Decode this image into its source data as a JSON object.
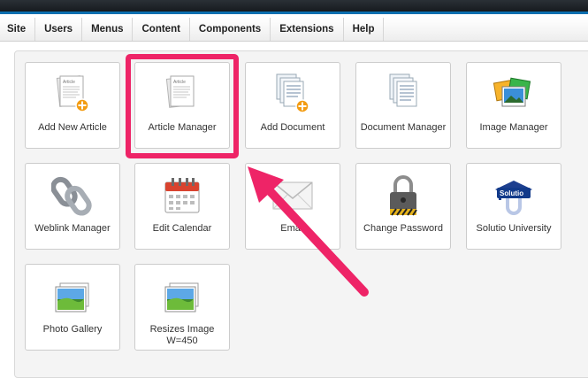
{
  "menubar": {
    "items": [
      {
        "label": "Site"
      },
      {
        "label": "Users"
      },
      {
        "label": "Menus"
      },
      {
        "label": "Content"
      },
      {
        "label": "Components"
      },
      {
        "label": "Extensions"
      },
      {
        "label": "Help"
      }
    ]
  },
  "cpanel": {
    "tiles": [
      {
        "label": "Add New Article",
        "icon": "add-article-icon"
      },
      {
        "label": "Article Manager",
        "icon": "article-manager-icon"
      },
      {
        "label": "Add Document",
        "icon": "add-document-icon"
      },
      {
        "label": "Document Manager",
        "icon": "document-manager-icon"
      },
      {
        "label": "Image Manager",
        "icon": "image-manager-icon"
      },
      {
        "label": "Weblink Manager",
        "icon": "chain-link-icon"
      },
      {
        "label": "Edit Calendar",
        "icon": "calendar-icon"
      },
      {
        "label": "Email",
        "icon": "envelope-icon"
      },
      {
        "label": "Change Password",
        "icon": "padlock-icon"
      },
      {
        "label": "Solutio University",
        "icon": "solutio-logo-icon"
      },
      {
        "label": "Photo Gallery",
        "icon": "photo-icon"
      },
      {
        "label": "Resizes Image W=450",
        "icon": "photo-icon"
      }
    ],
    "document_mini_text": "Article"
  },
  "colors": {
    "highlight": "#ee2467",
    "arrow": "#ee2467",
    "topbar": "#1c2126",
    "accent_line": "#0c6fb0",
    "plus_badge": "#f39c12"
  },
  "annotation": {
    "highlighted_tile": "Article Manager"
  }
}
